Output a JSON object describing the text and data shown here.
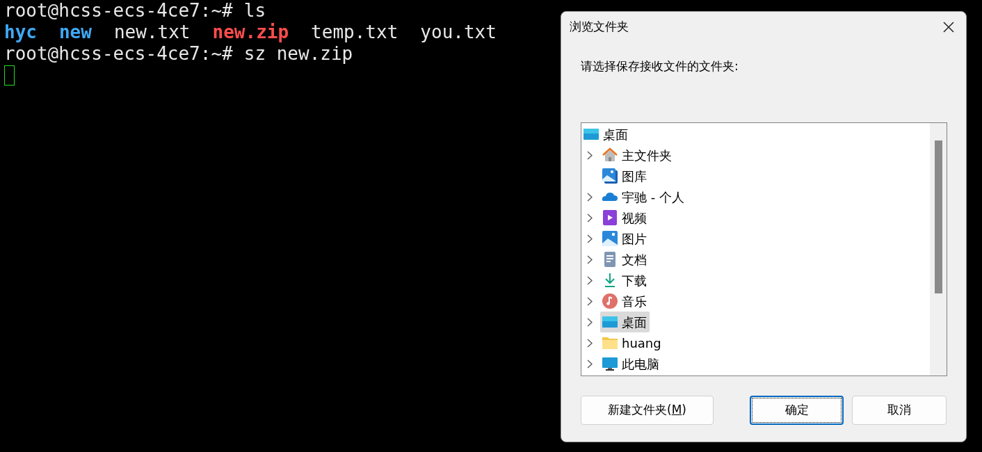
{
  "terminal": {
    "lines": [
      {
        "kind": "command",
        "prompt": "root@hcss-ecs-4ce7:~#",
        "command": "ls"
      },
      {
        "kind": "listing",
        "entries": [
          {
            "name": "hyc",
            "kind": "directory"
          },
          {
            "name": "new",
            "kind": "directory"
          },
          {
            "name": "new.txt",
            "kind": "file"
          },
          {
            "name": "new.zip",
            "kind": "archive"
          },
          {
            "name": "temp.txt",
            "kind": "file"
          },
          {
            "name": "you.txt",
            "kind": "file"
          }
        ]
      },
      {
        "kind": "command",
        "prompt": "root@hcss-ecs-4ce7:~#",
        "command": "sz new.zip"
      },
      {
        "kind": "cursor"
      }
    ]
  },
  "dialog": {
    "title": "浏览文件夹",
    "prompt": "请选择保存接收文件的文件夹:",
    "tree": {
      "label": "桌面",
      "kind": "desktop",
      "selected": false,
      "children": [
        {
          "label": "主文件夹",
          "kind": "home",
          "expandable": true,
          "selected": false
        },
        {
          "label": "图库",
          "kind": "gallery",
          "expandable": false,
          "selected": false
        },
        {
          "label": "宇驰 - 个人",
          "kind": "cloud",
          "expandable": true,
          "selected": false
        },
        {
          "label": "视频",
          "kind": "video",
          "expandable": true,
          "selected": false
        },
        {
          "label": "图片",
          "kind": "pictures",
          "expandable": true,
          "selected": false
        },
        {
          "label": "文档",
          "kind": "documents",
          "expandable": true,
          "selected": false
        },
        {
          "label": "下载",
          "kind": "downloads",
          "expandable": true,
          "selected": false
        },
        {
          "label": "音乐",
          "kind": "music",
          "expandable": true,
          "selected": false
        },
        {
          "label": "桌面",
          "kind": "desktop",
          "expandable": true,
          "selected": true
        },
        {
          "label": "huang",
          "kind": "folder",
          "expandable": true,
          "selected": false
        },
        {
          "label": "此电脑",
          "kind": "computer",
          "expandable": true,
          "selected": false
        }
      ]
    },
    "buttons": [
      {
        "text_before": "新建文件夹(",
        "accelerator": "M",
        "text_after": ")",
        "default": false
      },
      {
        "text_before": "确定",
        "default": true
      },
      {
        "text_before": "取消",
        "default": false
      }
    ]
  }
}
